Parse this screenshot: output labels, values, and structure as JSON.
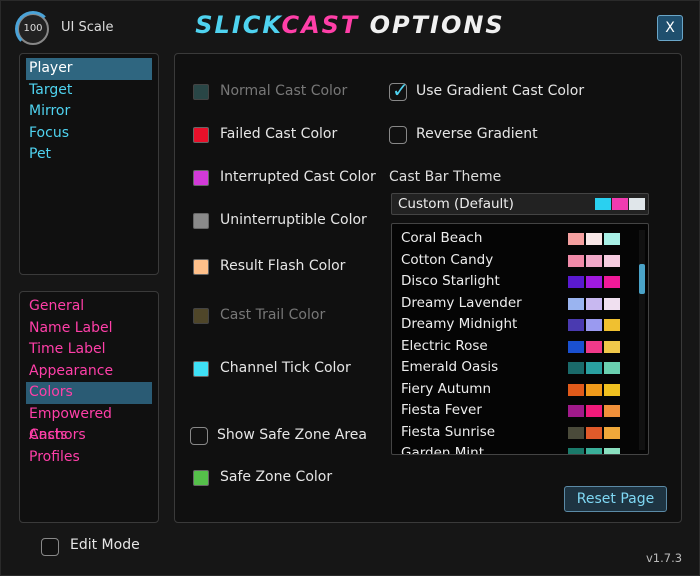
{
  "header": {
    "scale_value": "100",
    "scale_label": "UI Scale",
    "title_part1": "SLICK",
    "title_part2": "CAST",
    "title_part3": " OPTIONS",
    "close_label": "X"
  },
  "unit_nav": {
    "items": [
      {
        "label": "Player",
        "selected": true
      },
      {
        "label": "Target"
      },
      {
        "label": "Mirror"
      },
      {
        "label": "Focus"
      },
      {
        "label": "Pet"
      }
    ]
  },
  "category_nav": {
    "items": [
      {
        "label": "General"
      },
      {
        "label": "Name Label"
      },
      {
        "label": "Time Label"
      },
      {
        "label": "Appearance"
      },
      {
        "label": "Colors",
        "selected": true
      },
      {
        "label": "Empowered Casts"
      },
      {
        "label": "Anchors"
      },
      {
        "label": "Profiles"
      }
    ]
  },
  "colors": {
    "normal_cast": {
      "label": "Normal Cast Color",
      "color": "#3b6b6b",
      "disabled": true
    },
    "failed_cast": {
      "label": "Failed Cast Color",
      "color": "#e8102a"
    },
    "interrupted_cast": {
      "label": "Interrupted Cast Color",
      "color": "#d23ad8"
    },
    "uninterruptible": {
      "label": "Uninterruptible Color",
      "color": "#8a8a8a"
    },
    "result_flash": {
      "label": "Result Flash Color",
      "color": "#ffc08a"
    },
    "cast_trail": {
      "label": "Cast Trail Color",
      "color": "#7a6a3a",
      "disabled": true
    },
    "channel_tick": {
      "label": "Channel Tick Color",
      "color": "#3fe0f5"
    },
    "show_safe_zone": {
      "label": "Show Safe Zone Area",
      "checked": false
    },
    "safe_zone": {
      "label": "Safe Zone Color",
      "color": "#55c04a"
    },
    "use_gradient": {
      "label": "Use Gradient Cast Color",
      "checked": true
    },
    "reverse_gradient": {
      "label": "Reverse Gradient",
      "checked": false
    }
  },
  "theme": {
    "label": "Cast Bar Theme",
    "selected": "Custom (Default)",
    "selected_colors": [
      "#2ad0f0",
      "#f03cb0",
      "#e0e6ea"
    ],
    "options": [
      {
        "name": "Coral Beach",
        "colors": [
          "#f5a0a0",
          "#f8e6e6",
          "#a8f0e6"
        ]
      },
      {
        "name": "Cotton Candy",
        "colors": [
          "#f08aa8",
          "#f0a8c8",
          "#f6cce0"
        ]
      },
      {
        "name": "Disco Starlight",
        "colors": [
          "#5a1ad0",
          "#a01ae0",
          "#f01a9a"
        ]
      },
      {
        "name": "Dreamy Lavender",
        "colors": [
          "#9ab4f0",
          "#c8b8f0",
          "#f0e0f0"
        ]
      },
      {
        "name": "Dreamy Midnight",
        "colors": [
          "#4a3ab0",
          "#9a9af0",
          "#f0c030"
        ]
      },
      {
        "name": "Electric Rose",
        "colors": [
          "#1a50d0",
          "#f03a8a",
          "#f0c84a"
        ]
      },
      {
        "name": "Emerald Oasis",
        "colors": [
          "#1a6a6a",
          "#2aa0a0",
          "#6ad0b0"
        ]
      },
      {
        "name": "Fiery Autumn",
        "colors": [
          "#e05a1a",
          "#f09a1a",
          "#f0c020"
        ]
      },
      {
        "name": "Fiesta Fever",
        "colors": [
          "#a01a8a",
          "#f01a7a",
          "#f0903a"
        ]
      },
      {
        "name": "Fiesta Sunrise",
        "colors": [
          "#4a4a3a",
          "#e05a2a",
          "#f0a83a"
        ]
      },
      {
        "name": "Garden Mint",
        "colors": [
          "#1a7a6a",
          "#3ab09a",
          "#8ae0c0"
        ]
      }
    ]
  },
  "reset_label": "Reset Page",
  "edit_mode_label": "Edit Mode",
  "version": "v1.7.3"
}
